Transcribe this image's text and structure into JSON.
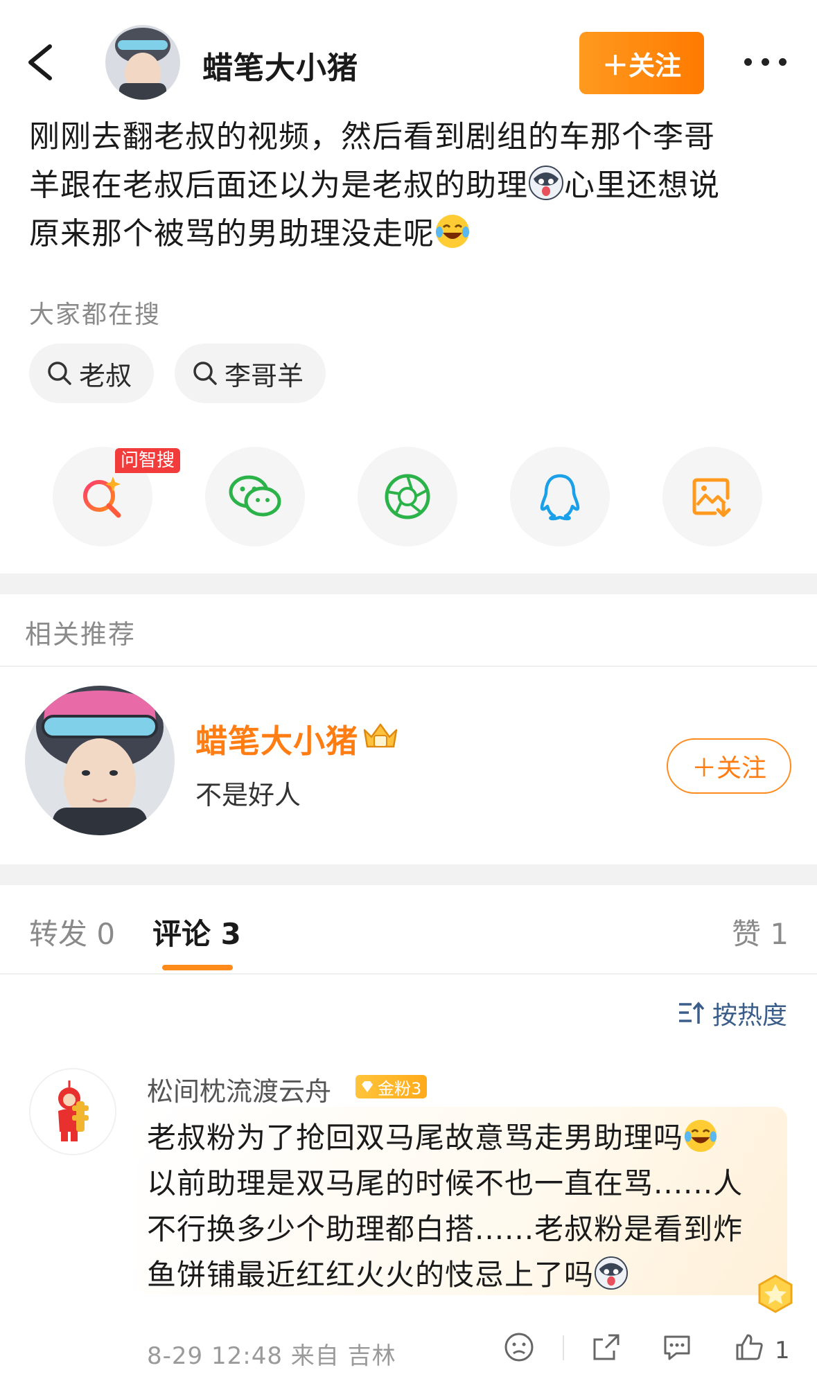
{
  "header": {
    "back_icon": "chevron-left-icon",
    "username": "蜡笔大小猪",
    "follow_label": "＋关注",
    "more_icon": "more-horizontal-icon"
  },
  "post": {
    "line1": "刚刚去翻老叔的视频，然后看到剧组的车那个李哥",
    "line2_a": "羊跟在老叔后面还以为是老叔的助理",
    "line2_b": "心里还想说",
    "line3": "原来那个被骂的男助理没走呢"
  },
  "hot_search": {
    "title": "大家都在搜",
    "chips": [
      "老叔",
      "李哥羊"
    ]
  },
  "share": {
    "ai_badge": "问智搜",
    "buttons": [
      "ai-search-icon",
      "wechat-icon",
      "moments-icon",
      "qq-icon",
      "save-image-icon"
    ]
  },
  "recommend": {
    "title": "相关推荐",
    "name": "蜡笔大小猪",
    "desc": "不是好人",
    "follow_label": "＋关注"
  },
  "tabs": {
    "repost": "转发 0",
    "comments": "评论 3",
    "likes": "赞 1"
  },
  "sort": {
    "label": "按热度"
  },
  "comment": {
    "user": "松间枕流渡云舟",
    "fan_badge": "金粉3",
    "line1": "老叔粉为了抢回双马尾故意骂走男助理吗",
    "line2": "以前助理是双马尾的时候不也一直在骂......人",
    "line3": "不行换多少个助理都白搭......老叔粉是看到炸",
    "line4": "鱼饼铺最近红红火火的忮忌上了吗",
    "meta": "8-29 12:48  来自 吉林",
    "like_count": "1"
  },
  "colors": {
    "accent_orange": "#ff7d13",
    "sort_blue": "#3b5d8a",
    "badge_red": "#f23b3b"
  }
}
